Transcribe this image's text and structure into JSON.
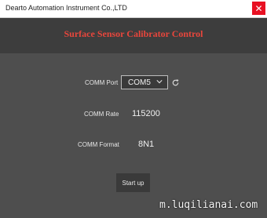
{
  "window": {
    "title": "Dearto Automation Instrument Co.,LTD",
    "close_glyph": "✕"
  },
  "header": {
    "title": "Surface Sensor Calibrator Control",
    "title_color": "#e8463c"
  },
  "form": {
    "comm_port_label": "COMM Port",
    "comm_port_value": "COM5",
    "comm_rate_label": "COMM Rate",
    "comm_rate_value": "115200",
    "comm_format_label": "COMM Format",
    "comm_format_value": "8N1",
    "icons": {
      "dropdown": "chevron-down-icon",
      "refresh": "refresh-icon"
    }
  },
  "actions": {
    "startup_label": "Start up"
  },
  "watermark": {
    "text": "m.luqilianai.com"
  }
}
